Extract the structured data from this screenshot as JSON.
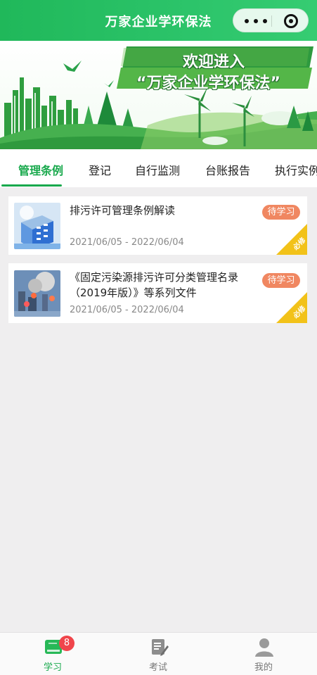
{
  "header": {
    "title": "万家企业学环保法"
  },
  "banner": {
    "line1": "欢迎进入",
    "line2": "“万家企业学环保法”"
  },
  "tabs": [
    {
      "label": "管理条例",
      "active": true
    },
    {
      "label": "登记"
    },
    {
      "label": "自行监测"
    },
    {
      "label": "台账报告"
    },
    {
      "label": "执行实例"
    }
  ],
  "courses": [
    {
      "title": "排污许可管理条例解读",
      "date_range": "2021/06/05 - 2022/06/04",
      "status": "待学习",
      "tag": "必修",
      "thumb_icon": "building-document-icon"
    },
    {
      "title": "《固定污染源排污许可分类管理名录（2019年版）》等系列文件",
      "date_range": "2021/06/05 - 2022/06/04",
      "status": "待学习",
      "tag": "必修",
      "thumb_icon": "pollution-factory-icon"
    }
  ],
  "nav": {
    "items": [
      {
        "label": "学习",
        "icon": "book-icon",
        "badge": "8",
        "active": true
      },
      {
        "label": "考试",
        "icon": "exam-edit-icon"
      },
      {
        "label": "我的",
        "icon": "user-icon"
      }
    ]
  },
  "colors": {
    "primary": "#19a94d",
    "badge": "#f08761",
    "ribbon": "#f2c219",
    "notify": "#f0454b"
  }
}
